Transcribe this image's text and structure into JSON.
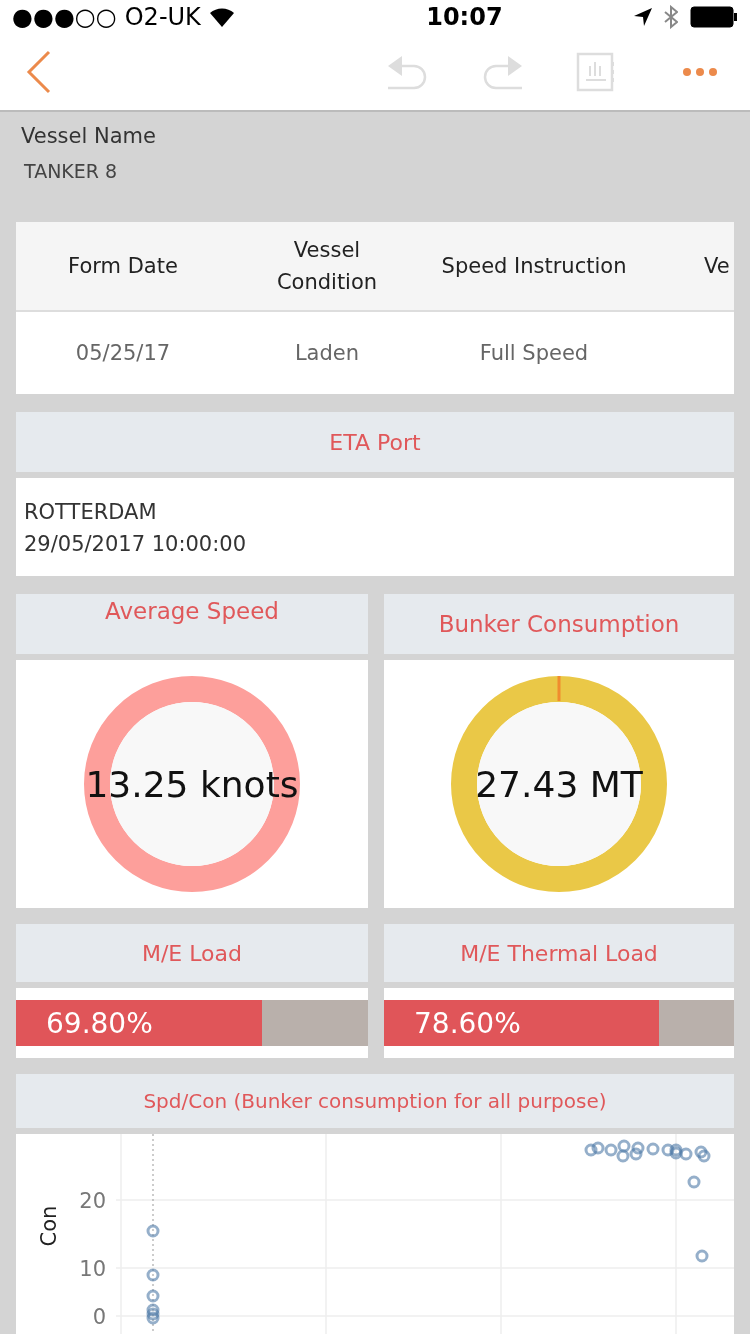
{
  "status_bar": {
    "signal_dots": "●●●○○",
    "carrier": "O2-UK",
    "time": "10:07"
  },
  "nav": {
    "back_enabled": true,
    "undo_enabled": false,
    "redo_enabled": false
  },
  "vessel": {
    "label": "Vessel Name",
    "value": "TANKER 8"
  },
  "table": {
    "columns": [
      "Form Date",
      "Vessel Condition",
      "Speed Instruction",
      "Ve"
    ],
    "rows": [
      [
        "05/25/17",
        "Laden",
        "Full Speed"
      ]
    ]
  },
  "eta": {
    "title": "ETA Port",
    "lines": [
      "ROTTERDAM",
      "29/05/2017 10:00:00"
    ]
  },
  "gauges": [
    {
      "title": "Average Speed",
      "value": "13.25 knots",
      "color": "#fd9f9b"
    },
    {
      "title": "Bunker Consumption",
      "value": "27.43 MT",
      "color": "#eac847"
    }
  ],
  "loads": [
    {
      "title": "M/E Load",
      "reading": "69.80%",
      "level": 0.698
    },
    {
      "title": "M/E Thermal Load",
      "reading": "78.60%",
      "level": 0.786
    }
  ],
  "scatter": {
    "title": "Spd/Con (Bunker consumption for all purpose)",
    "y_axis_title": "Con",
    "y_ticks": [
      "20",
      "10",
      "0"
    ]
  }
}
